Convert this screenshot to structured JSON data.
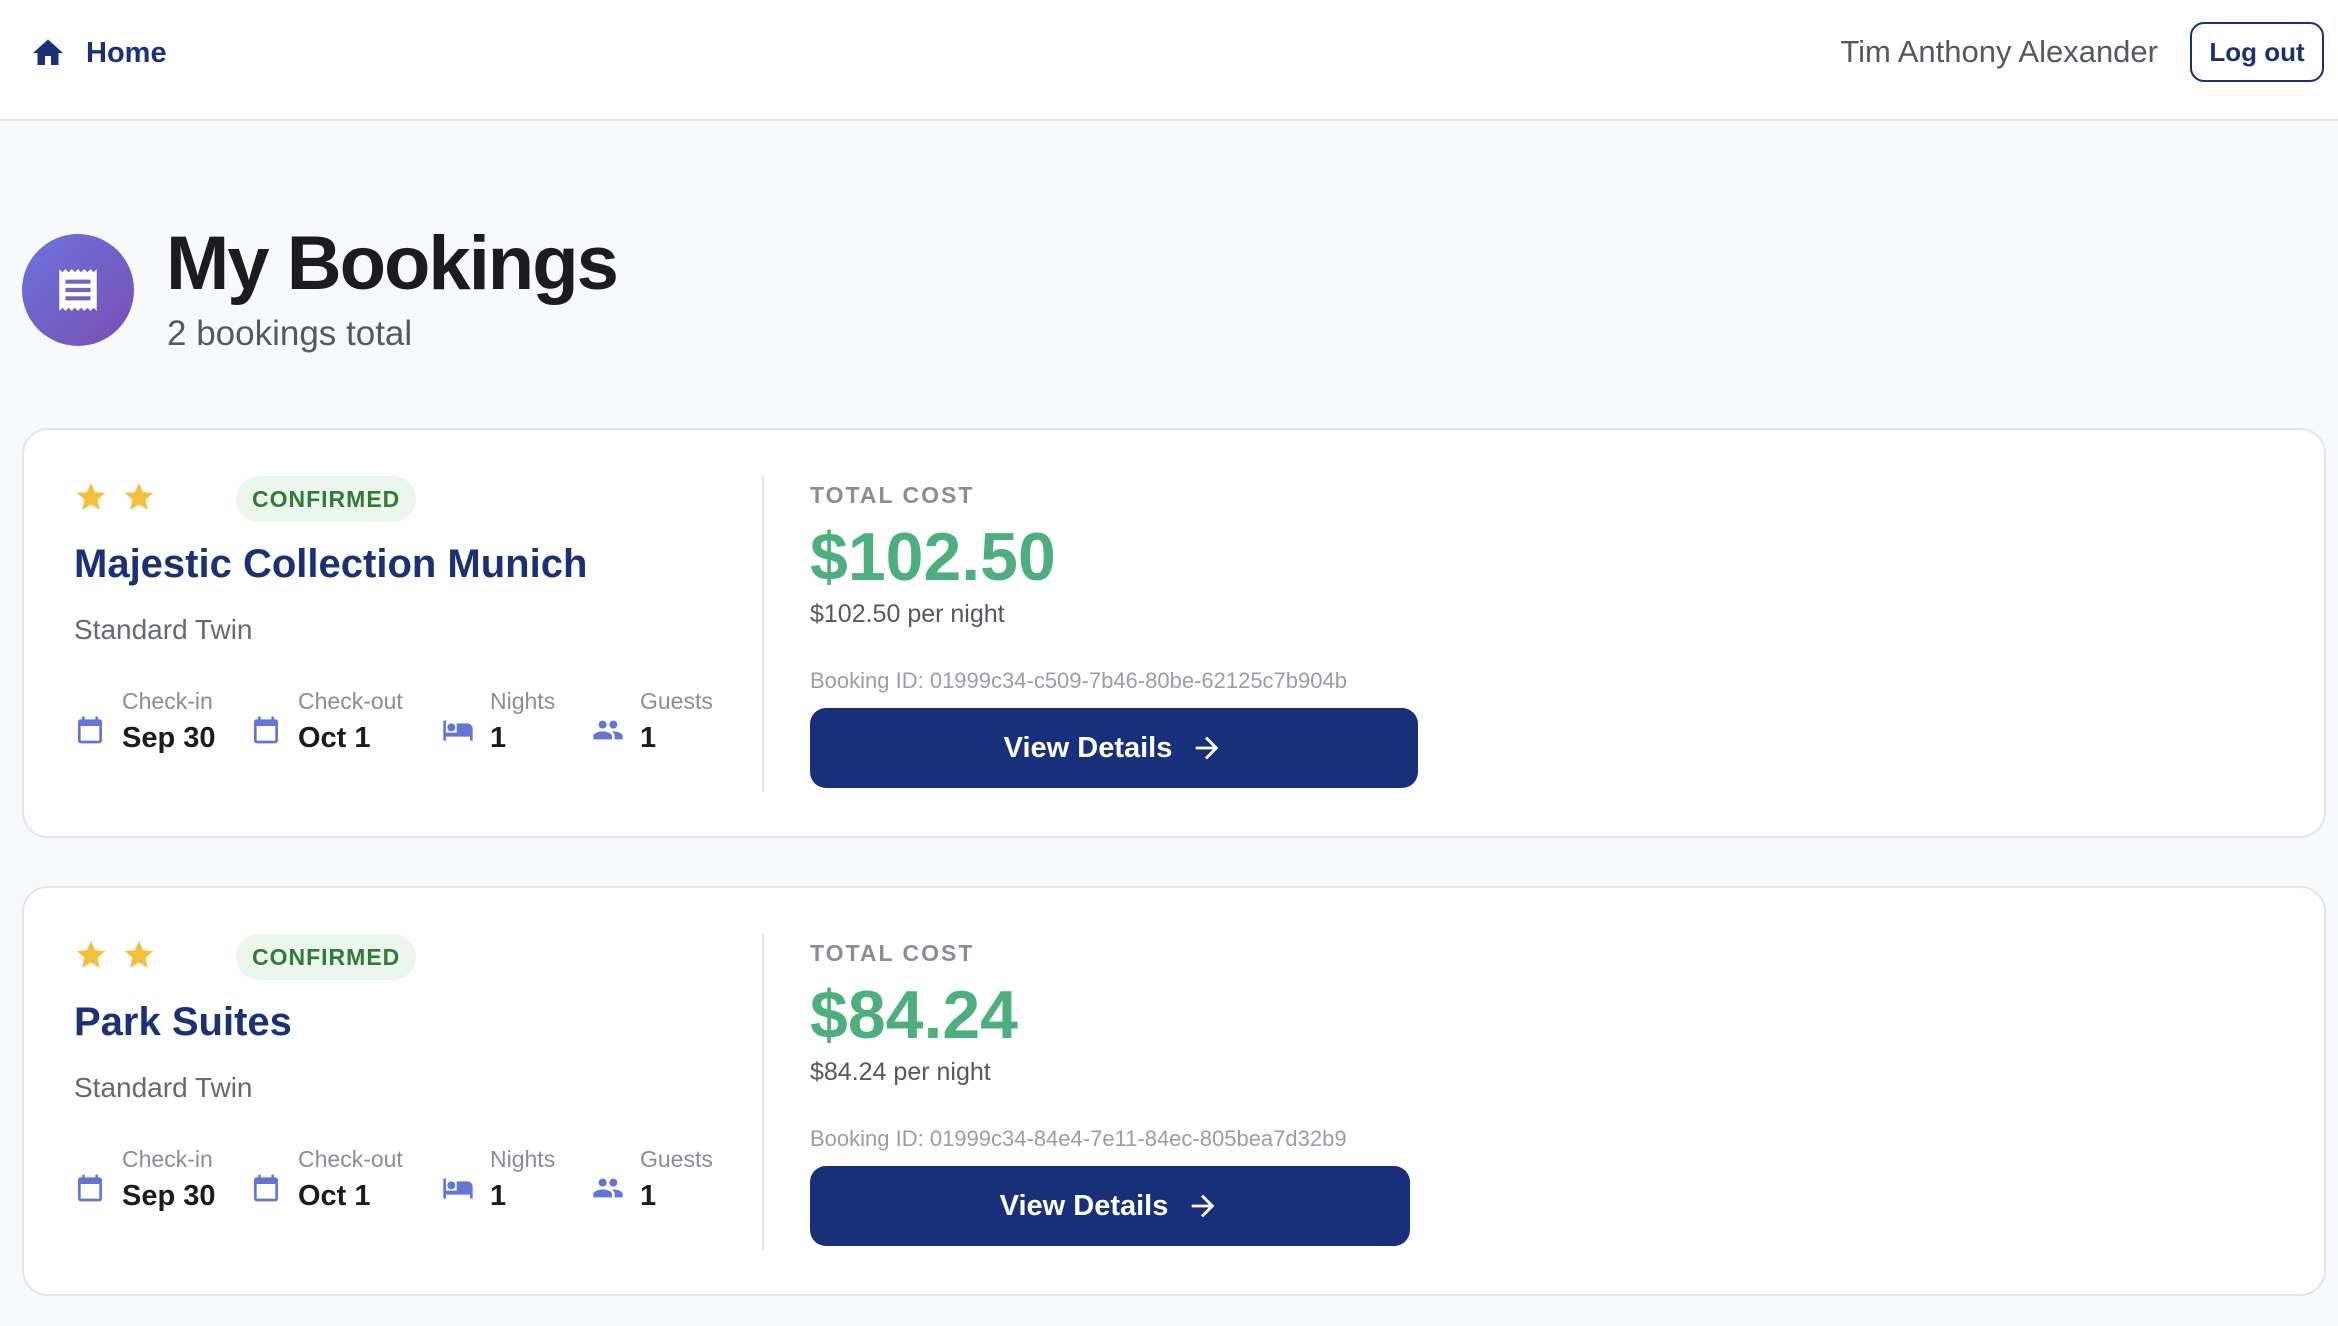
{
  "nav": {
    "home_label": "Home",
    "user_name": "Tim Anthony Alexander",
    "logout_label": "Log out"
  },
  "header": {
    "title": "My Bookings",
    "subtitle": "2 bookings total",
    "icon": "receipt-icon"
  },
  "colors": {
    "brand": "#1a3178",
    "cost_green": "#4caf7d",
    "badge_green": "#2e7d32",
    "star": "#f4bf3a",
    "stat_icon": "#6475d6"
  },
  "labels": {
    "checkin": "Check-in",
    "checkout": "Check-out",
    "nights": "Nights",
    "guests": "Guests",
    "total_cost": "TOTAL COST",
    "view_details": "View Details"
  },
  "bookings": [
    {
      "stars": 2,
      "status": "CONFIRMED",
      "hotel": "Majestic Collection Munich",
      "room": "Standard Twin",
      "checkin": "Sep 30",
      "checkout": "Oct 1",
      "nights": "1",
      "guests": "1",
      "total": "$102.50",
      "per_night": "$102.50 per night",
      "booking_id": "Booking ID: 01999c34-c509-7b46-80be-62125c7b904b"
    },
    {
      "stars": 2,
      "status": "CONFIRMED",
      "hotel": "Park Suites",
      "room": "Standard Twin",
      "checkin": "Sep 30",
      "checkout": "Oct 1",
      "nights": "1",
      "guests": "1",
      "total": "$84.24",
      "per_night": "$84.24 per night",
      "booking_id": "Booking ID: 01999c34-84e4-7e11-84ec-805bea7d32b9"
    }
  ]
}
